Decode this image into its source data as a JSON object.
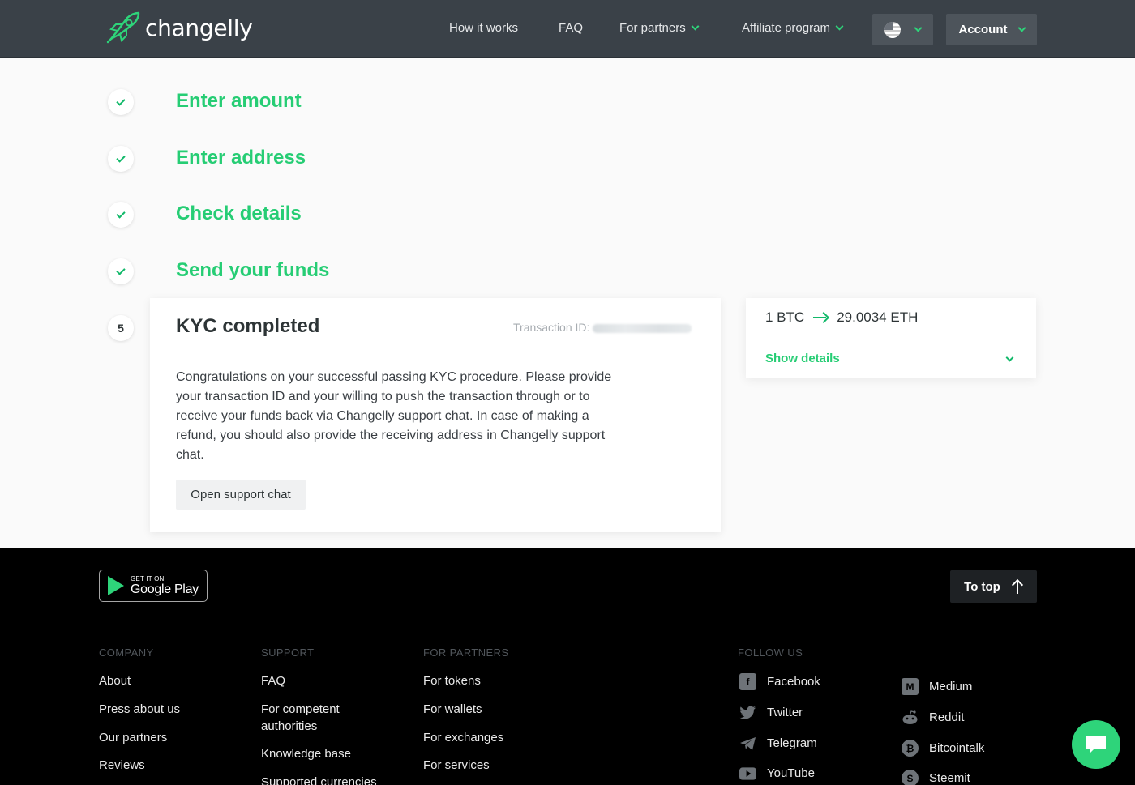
{
  "header": {
    "logo_text": "changelly",
    "nav": {
      "how_it_works": "How it works",
      "faq": "FAQ",
      "for_partners": "For partners",
      "affiliate": "Affiliate program"
    },
    "account_label": "Account"
  },
  "steps": [
    {
      "label": "Enter amount",
      "status": "done"
    },
    {
      "label": "Enter address",
      "status": "done"
    },
    {
      "label": "Check details",
      "status": "done"
    },
    {
      "label": "Send your funds",
      "status": "done"
    }
  ],
  "kyc_card": {
    "step_number": "5",
    "title": "KYC completed",
    "transaction_id_label": "Transaction ID:",
    "body": "Congratulations on your successful passing KYC procedure. Please provide your transaction ID and your willing to push the transaction through or to receive your funds back via Changelly support chat. In case of making a refund, you should also provide the receiving address in Changelly support chat.",
    "support_button": "Open support chat"
  },
  "rate_card": {
    "from": "1 BTC",
    "to": "29.0034 ETH",
    "show_details": "Show details"
  },
  "footer": {
    "gplay_small": "GET IT ON",
    "gplay_big": "Google Play",
    "to_top": "To top",
    "company": {
      "heading": "COMPANY",
      "links": [
        "About",
        "Press about us",
        "Our partners",
        "Reviews"
      ]
    },
    "support": {
      "heading": "SUPPORT",
      "links": [
        "FAQ",
        "For competent authorities",
        "Knowledge base",
        "Supported currencies"
      ]
    },
    "partners": {
      "heading": "FOR PARTNERS",
      "links": [
        "For tokens",
        "For wallets",
        "For exchanges",
        "For services"
      ]
    },
    "follow": {
      "heading": "FOLLOW US",
      "left": [
        "Facebook",
        "Twitter",
        "Telegram",
        "YouTube"
      ],
      "right": [
        "Medium",
        "Reddit",
        "Bitcointalk",
        "Steemit"
      ]
    }
  },
  "colors": {
    "accent": "#26cd74",
    "header_bg": "#3a4148",
    "footer_bg": "#000000"
  }
}
